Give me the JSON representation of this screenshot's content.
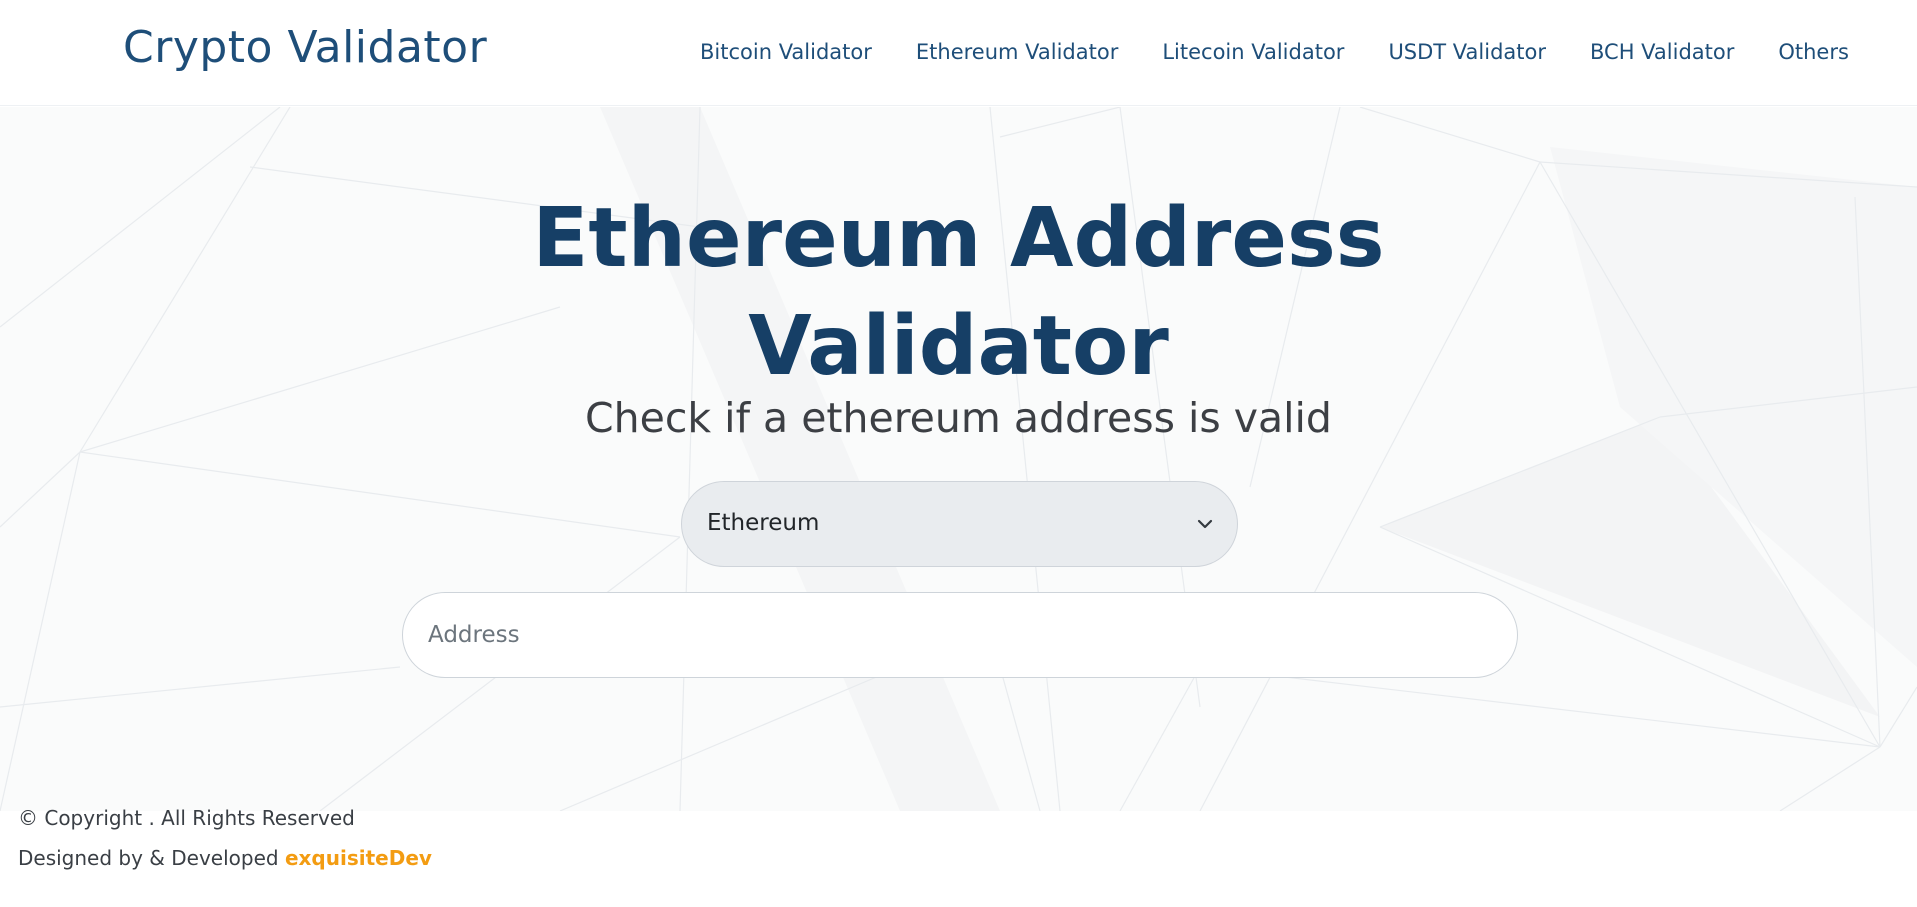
{
  "header": {
    "brand": "Crypto Validator",
    "nav": [
      "Bitcoin Validator",
      "Ethereum Validator",
      "Litecoin Validator",
      "USDT Validator",
      "BCH Validator",
      "Others"
    ]
  },
  "hero": {
    "title_line1": "Ethereum Address",
    "title_line2": "Validator",
    "subtitle": "Check if a ethereum address is valid"
  },
  "form": {
    "coin_select_value": "Ethereum",
    "address_placeholder": "Address",
    "address_value": ""
  },
  "footer": {
    "copyright": "© Copyright . All Rights Reserved",
    "credit_prefix": "Designed by & Developed",
    "credit_name": "exquisiteDev"
  },
  "colors": {
    "brand": "#1e4e79",
    "title": "#163f66",
    "accent": "#f39c12",
    "select_bg": "#e9ecef"
  }
}
